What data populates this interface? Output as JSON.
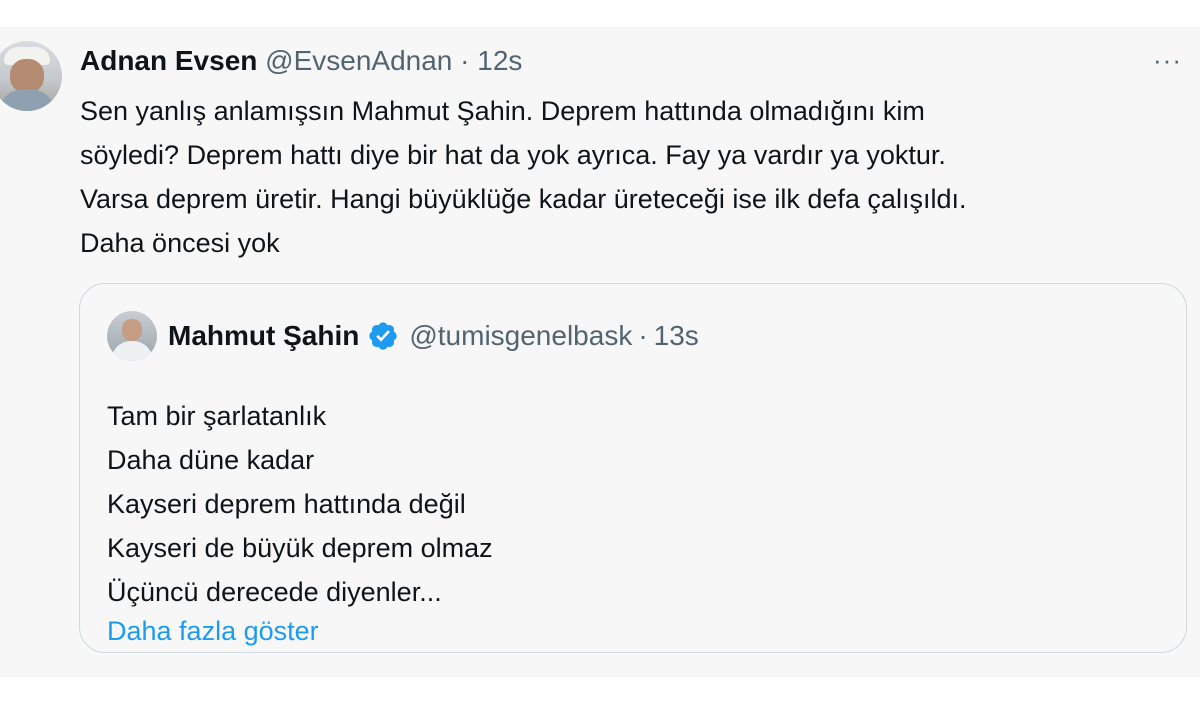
{
  "tweet": {
    "author_name": "Adnan Evsen",
    "handle": "@EvsenAdnan",
    "separator": "·",
    "time": "12s",
    "more_icon": "···",
    "text_lines": [
      "Sen yanlış anlamışsın Mahmut Şahin. Deprem hattında olmadığını kim",
      "söyledi? Deprem hattı diye bir hat da yok ayrıca. Fay ya vardır ya yoktur.",
      "Varsa deprem üretir. Hangi büyüklüğe kadar üreteceği ise ilk defa çalışıldı.",
      "Daha öncesi yok"
    ]
  },
  "quote": {
    "author_name": "Mahmut Şahin",
    "verified": true,
    "handle": "@tumisgenelbask",
    "separator": "·",
    "time": "13s",
    "text_lines": [
      "Tam bir şarlatanlık",
      "Daha düne kadar",
      "Kayseri deprem hattında değil",
      "Kayseri de büyük deprem olmaz",
      "Üçüncü derecede diyenler..."
    ],
    "show_more_label": "Daha fazla göster"
  },
  "colors": {
    "link": "#1d9bf0",
    "secondary_text": "#536471",
    "border": "#cfd9de",
    "verified_badge": "#1d9bf0"
  }
}
